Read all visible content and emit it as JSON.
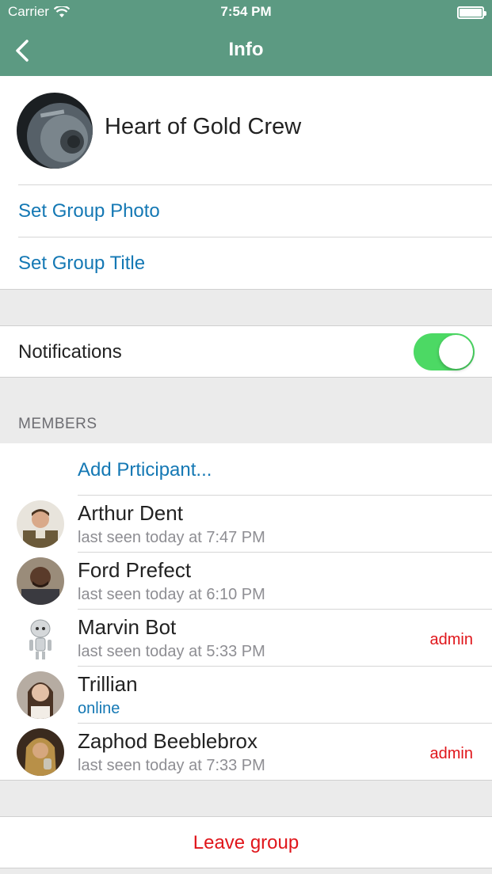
{
  "status_bar": {
    "carrier": "Carrier",
    "time": "7:54 PM",
    "wifi_icon": "wifi-icon",
    "battery_icon": "battery-icon"
  },
  "nav": {
    "title": "Info",
    "back_icon": "chevron-left-icon"
  },
  "group": {
    "name": "Heart of Gold Crew",
    "set_photo_label": "Set Group Photo",
    "set_title_label": "Set Group Title"
  },
  "notifications": {
    "label": "Notifications",
    "enabled": true
  },
  "members_header": "MEMBERS",
  "add_participant_label": "Add Prticipant...",
  "members": [
    {
      "name": "Arthur Dent",
      "status": "last seen today at 7:47 PM",
      "badge": ""
    },
    {
      "name": "Ford Prefect",
      "status": "last seen today at 6:10 PM",
      "badge": ""
    },
    {
      "name": "Marvin Bot",
      "status": "last seen today at 5:33 PM",
      "badge": "admin"
    },
    {
      "name": "Trillian",
      "status": "online",
      "badge": ""
    },
    {
      "name": "Zaphod Beeblebrox",
      "status": "last seen today at 7:33 PM",
      "badge": "admin"
    }
  ],
  "leave_label": "Leave group",
  "colors": {
    "nav": "#5c9a82",
    "link": "#1478b4",
    "destructive": "#e0161b",
    "toggle_on": "#4cd964"
  }
}
